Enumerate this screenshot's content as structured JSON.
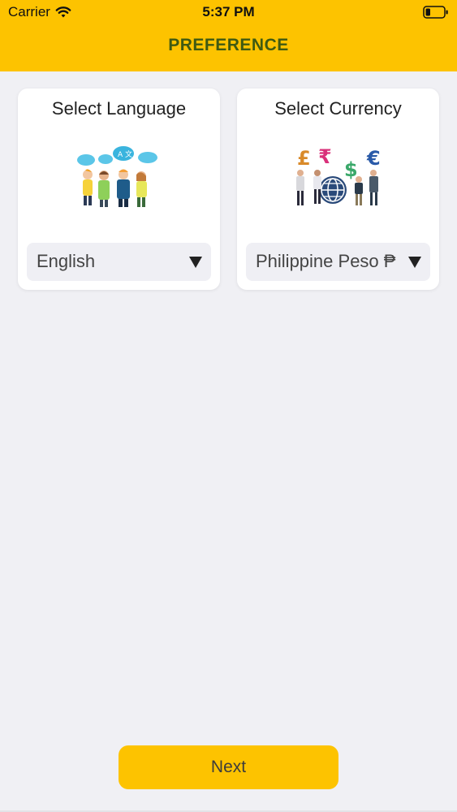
{
  "status_bar": {
    "carrier": "Carrier",
    "time": "5:37 PM"
  },
  "header": {
    "title": "PREFERENCE"
  },
  "language_card": {
    "title": "Select Language",
    "selected": "English",
    "icon": "multilingual-people-illustration"
  },
  "currency_card": {
    "title": "Select Currency",
    "selected": "Philippine Peso ₱",
    "icon": "currency-people-illustration"
  },
  "footer": {
    "next_label": "Next"
  },
  "colors": {
    "accent": "#fdc300",
    "title_text": "#3f5a12",
    "background": "#f0f0f4"
  }
}
